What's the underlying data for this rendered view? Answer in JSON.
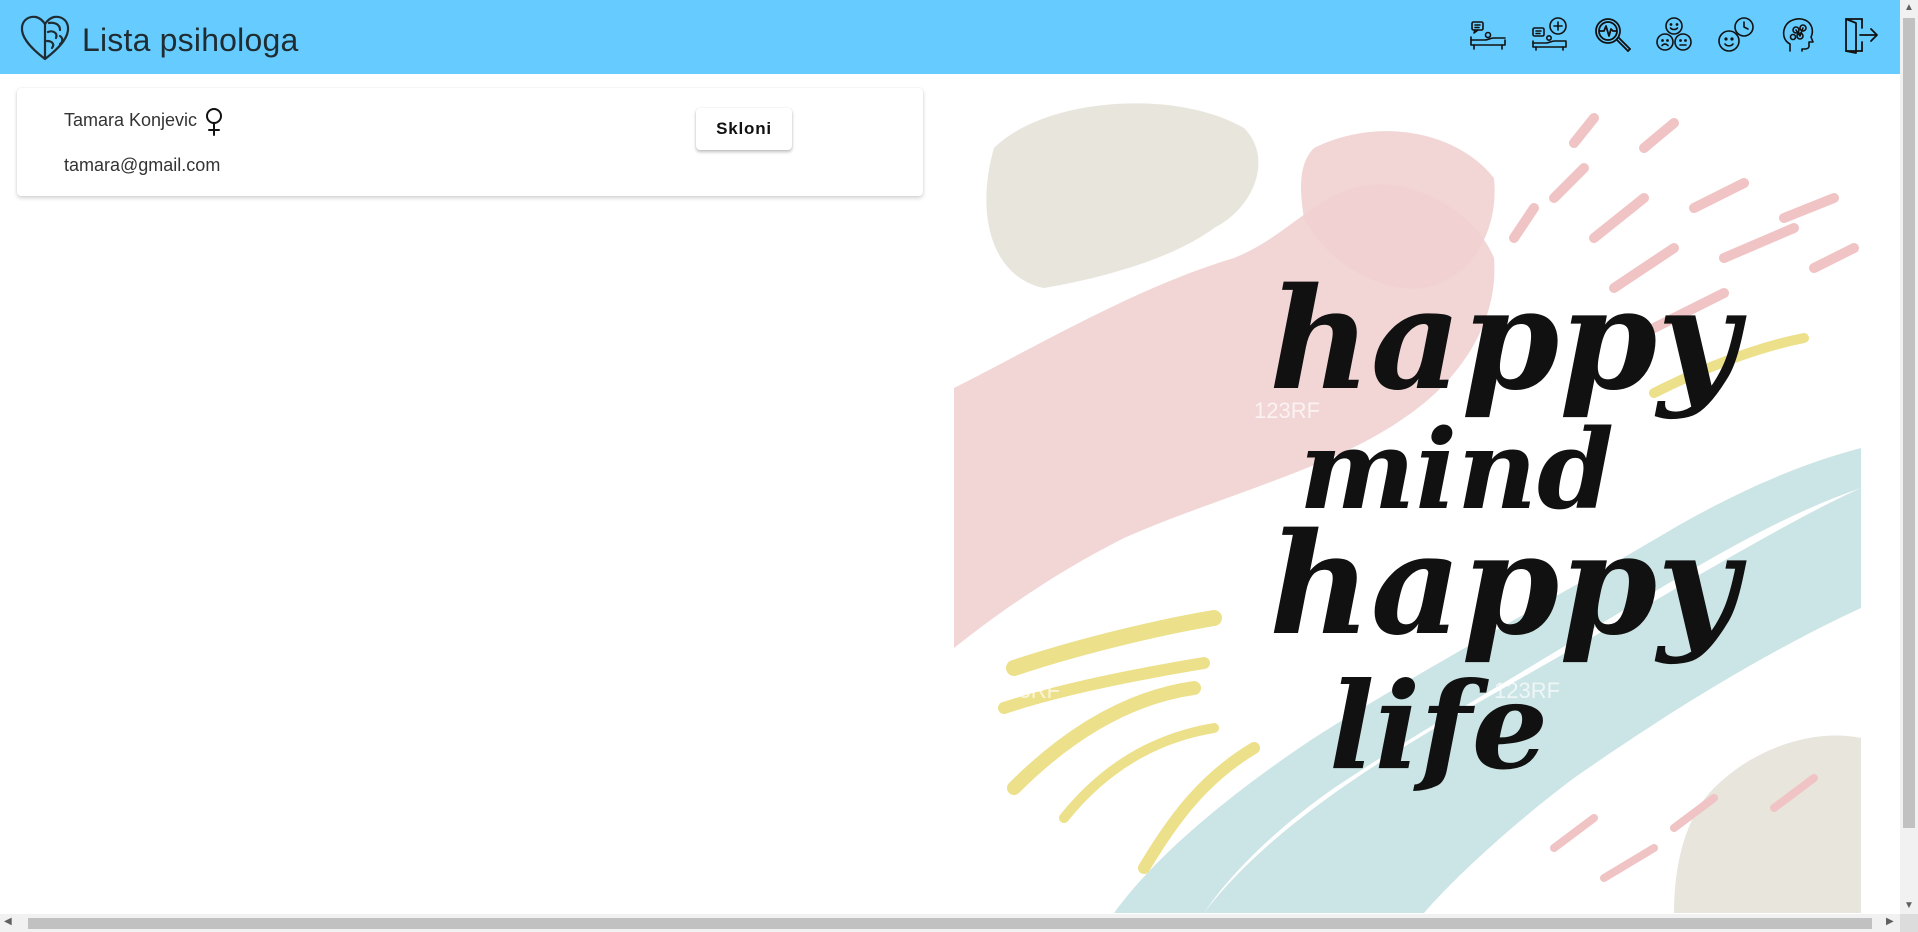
{
  "header": {
    "title": "Lista psihologa",
    "background": "#66ccff",
    "nav_icons": [
      "therapy-couch-chat-icon",
      "therapy-couch-add-icon",
      "magnifier-heartbeat-icon",
      "group-emotions-icon",
      "smiley-clock-icon",
      "head-brain-icon",
      "logout-icon"
    ]
  },
  "psychologist": {
    "name": "Tamara Konjevic",
    "gender_icon": "female-symbol-icon",
    "email": "tamara@gmail.com",
    "action_label": "Skloni"
  },
  "poster": {
    "text_lines": [
      "happy",
      "mind",
      "happy",
      "life"
    ],
    "watermark": "123RF"
  }
}
